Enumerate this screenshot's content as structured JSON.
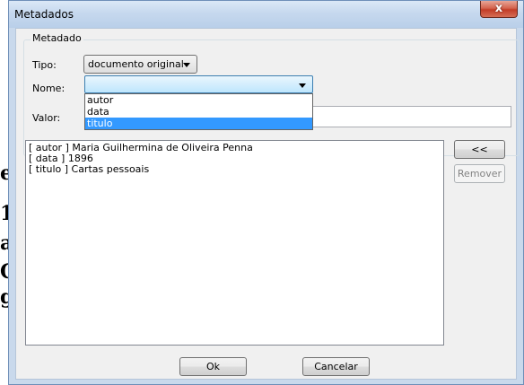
{
  "window": {
    "title": "Metadados",
    "close_label": "x"
  },
  "group": {
    "label": "Metadado"
  },
  "form": {
    "tipo_label": "Tipo:",
    "tipo_value": "documento original",
    "nome_label": "Nome:",
    "nome_value": "",
    "valor_label": "Valor:",
    "valor_value": ""
  },
  "dropdown": {
    "options": [
      "autor",
      "data",
      "titulo"
    ],
    "selected_index": 2
  },
  "list": {
    "rows": [
      "[ autor ] Maria Guilhermina de Oliveira Penna",
      "[ data ] 1896",
      "[ titulo ] Cartas pessoais"
    ]
  },
  "buttons": {
    "add_label": "<<",
    "remove_label": "Remover",
    "ok_label": "Ok",
    "cancel_label": "Cancelar"
  },
  "background": {
    "glyphs": [
      "e",
      "1",
      "a",
      "C",
      "g"
    ]
  },
  "colors": {
    "selection": "#3399ff",
    "titlebar": "#c6d8ee",
    "close": "#c33d27"
  }
}
